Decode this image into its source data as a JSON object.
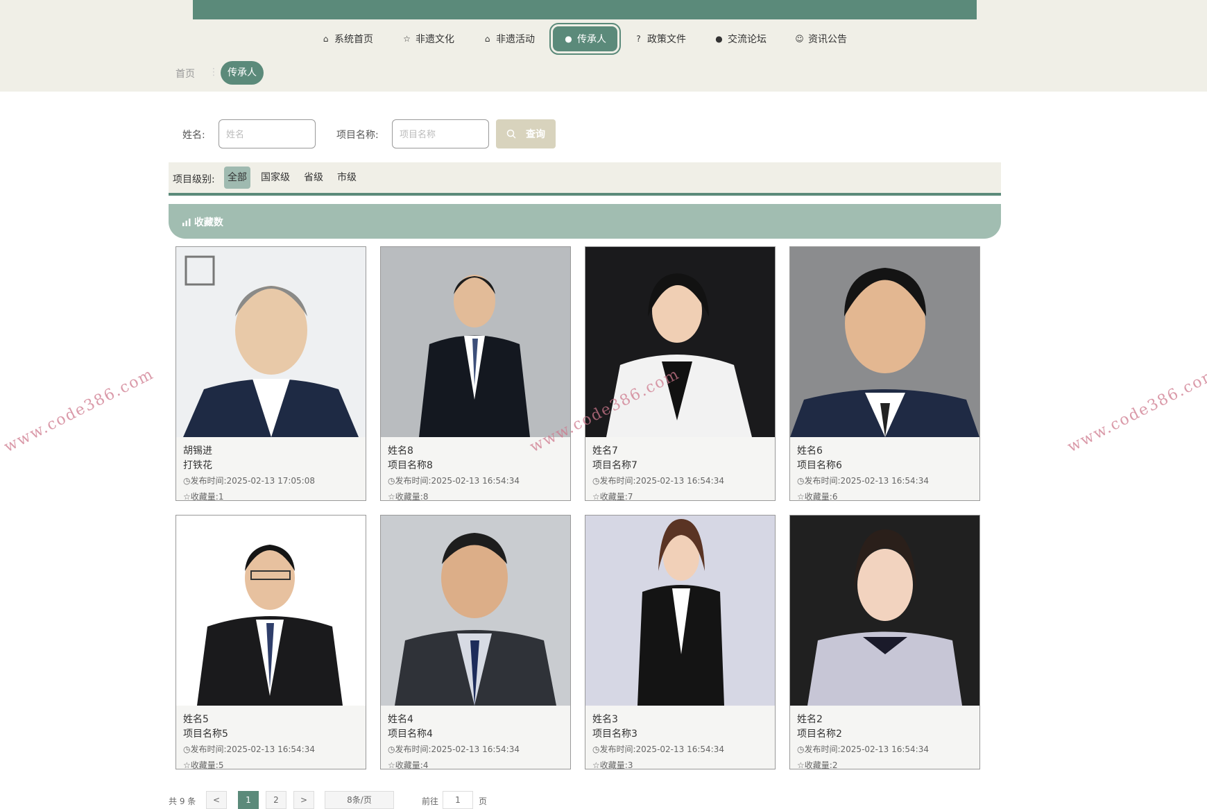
{
  "colors": {
    "accent": "#5b8a7a",
    "band": "#f0efe7",
    "sort_bar": "#a1bdb1",
    "query_btn": "#d8d3bd"
  },
  "nav": [
    {
      "label": "系统首页",
      "icon": "home-icon"
    },
    {
      "label": "非遗文化",
      "icon": "star-icon"
    },
    {
      "label": "非遗活动",
      "icon": "bag-icon"
    },
    {
      "label": "传承人",
      "icon": "info-circle-icon",
      "active": true
    },
    {
      "label": "政策文件",
      "icon": "question-circle-icon"
    },
    {
      "label": "交流论坛",
      "icon": "info-circle-icon"
    },
    {
      "label": "资讯公告",
      "icon": "smile-icon"
    }
  ],
  "breadcrumb": {
    "home": "首页",
    "current": "传承人"
  },
  "search": {
    "name_label": "姓名:",
    "name_placeholder": "姓名",
    "project_label": "项目名称:",
    "project_placeholder": "项目名称",
    "query_label": "查询"
  },
  "filter": {
    "label": "项目级别:",
    "options": [
      "全部",
      "国家级",
      "省级",
      "市级"
    ],
    "selected": "全部"
  },
  "sort": {
    "label": "收藏数"
  },
  "cards": [
    {
      "name": "胡锡进",
      "project": "打铁花",
      "time_label": "发布时间:",
      "time": "2025-02-13 17:05:08",
      "fav_label": "收藏量:",
      "fav": "1"
    },
    {
      "name": "姓名8",
      "project": "项目名称8",
      "time_label": "发布时间:",
      "time": "2025-02-13 16:54:34",
      "fav_label": "收藏量:",
      "fav": "8"
    },
    {
      "name": "姓名7",
      "project": "项目名称7",
      "time_label": "发布时间:",
      "time": "2025-02-13 16:54:34",
      "fav_label": "收藏量:",
      "fav": "7"
    },
    {
      "name": "姓名6",
      "project": "项目名称6",
      "time_label": "发布时间:",
      "time": "2025-02-13 16:54:34",
      "fav_label": "收藏量:",
      "fav": "6"
    },
    {
      "name": "姓名5",
      "project": "项目名称5",
      "time_label": "发布时间:",
      "time": "2025-02-13 16:54:34",
      "fav_label": "收藏量:",
      "fav": "5"
    },
    {
      "name": "姓名4",
      "project": "项目名称4",
      "time_label": "发布时间:",
      "time": "2025-02-13 16:54:34",
      "fav_label": "收藏量:",
      "fav": "4"
    },
    {
      "name": "姓名3",
      "project": "项目名称3",
      "time_label": "发布时间:",
      "time": "2025-02-13 16:54:34",
      "fav_label": "收藏量:",
      "fav": "3"
    },
    {
      "name": "姓名2",
      "project": "项目名称2",
      "time_label": "发布时间:",
      "time": "2025-02-13 16:54:34",
      "fav_label": "收藏量:",
      "fav": "2"
    }
  ],
  "pager": {
    "total": "共 9 条",
    "prev": "<",
    "pages": [
      "1",
      "2"
    ],
    "next": ">",
    "page_size": "8条/页",
    "goto": "前往",
    "goto_value": "1",
    "page_unit": "页"
  },
  "watermark": "www.code386.com"
}
